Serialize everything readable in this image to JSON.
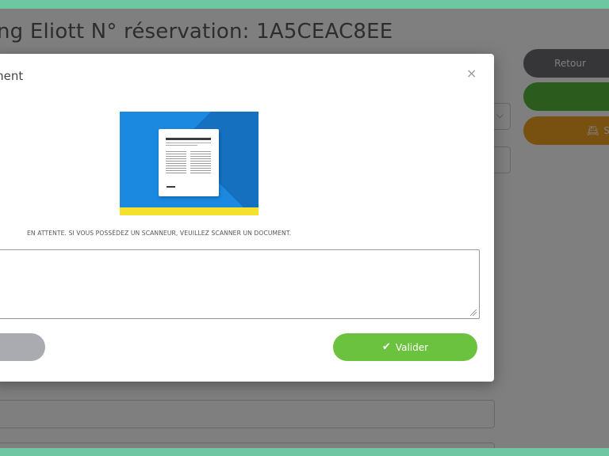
{
  "page": {
    "title": "ng Eliott N° réservation: 1A5CEAC8EE",
    "buttons": {
      "retour": "Retour",
      "green": "",
      "scan_partial": "S"
    }
  },
  "modal": {
    "title": "ment",
    "close": "×",
    "status": "EN ATTENTE. SI VOUS POSSÉDEZ UN SCANNEUR, VEUILLEZ SCANNER UN DOCUMENT.",
    "textarea_value": "",
    "cancel_label": "",
    "validate_label": "Valider",
    "validate_icon": "check-icon"
  },
  "colors": {
    "frame": "#6dc7a0",
    "validate": "#6bc23e",
    "retour": "#6c6c70",
    "green": "#56b63a",
    "orange": "#f1a020",
    "illustration_bg": "#1b89e0",
    "illustration_stripe": "#f5e12d"
  }
}
